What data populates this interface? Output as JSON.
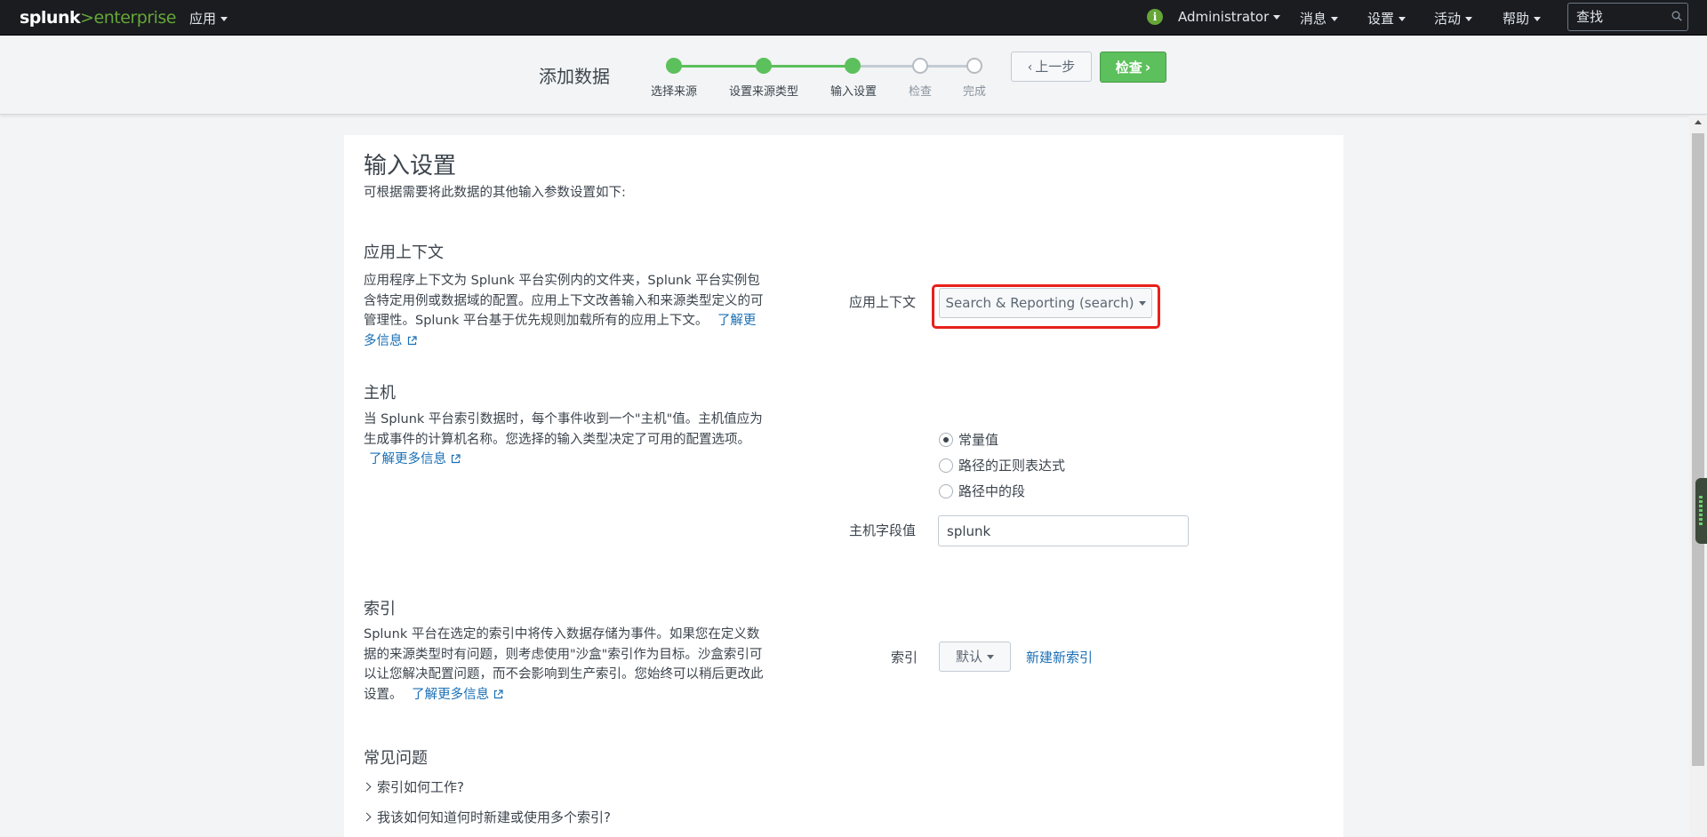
{
  "header": {
    "logo_splunk": "splunk",
    "logo_gt": ">",
    "logo_enterprise": "enterprise",
    "apps_menu": "应用",
    "user_menu": "Administrator",
    "messages_menu": "消息",
    "settings_menu": "设置",
    "activity_menu": "活动",
    "help_menu": "帮助",
    "search_placeholder": "查找",
    "info_icon": "i"
  },
  "wizard": {
    "title": "添加数据",
    "steps": [
      {
        "label": "选择来源",
        "status": "done"
      },
      {
        "label": "设置来源类型",
        "status": "done"
      },
      {
        "label": "输入设置",
        "status": "current"
      },
      {
        "label": "检查",
        "status": "todo"
      },
      {
        "label": "完成",
        "status": "todo"
      }
    ],
    "prev_button": "上一步",
    "next_button": "检查"
  },
  "content": {
    "title": "输入设置",
    "subtitle": "可根据需要将此数据的其他输入参数设置如下:",
    "app_context": {
      "heading": "应用上下文",
      "description": "应用程序上下文为 Splunk 平台实例内的文件夹，Splunk 平台实例包含特定用例或数据域的配置。应用上下文改善输入和来源类型定义的可管理性。Splunk 平台基于优先规则加载所有的应用上下文。",
      "learn_more": "了解更多信息",
      "field_label": "应用上下文",
      "selected_value": "Search & Reporting (search)"
    },
    "host": {
      "heading": "主机",
      "description": "当 Splunk 平台索引数据时，每个事件收到一个\"主机\"值。主机值应为生成事件的计算机名称。您选择的输入类型决定了可用的配置选项。",
      "learn_more": "了解更多信息",
      "options": [
        "常量值",
        "路径的正则表达式",
        "路径中的段"
      ],
      "selected_option": 0,
      "field_label": "主机字段值",
      "field_value": "splunk"
    },
    "index": {
      "heading": "索引",
      "description": "Splunk 平台在选定的索引中将传入数据存储为事件。如果您在定义数据的来源类型时有问题，则考虑使用\"沙盒\"索引作为目标。沙盒索引可以让您解决配置问题，而不会影响到生产索引。您始终可以稍后更改此设置。",
      "learn_more": "了解更多信息",
      "field_label": "索引",
      "selected_value": "默认",
      "create_link": "新建新索引"
    },
    "faq": {
      "heading": "常见问题",
      "items": [
        "索引如何工作?",
        "我该如何知道何时新建或使用多个索引?"
      ]
    }
  },
  "colors": {
    "topbar": "#1a1c20",
    "brand_green": "#65a637",
    "step_green": "#5cc05c",
    "link_blue": "#1a6fb5",
    "highlight_red": "#e8201b"
  }
}
